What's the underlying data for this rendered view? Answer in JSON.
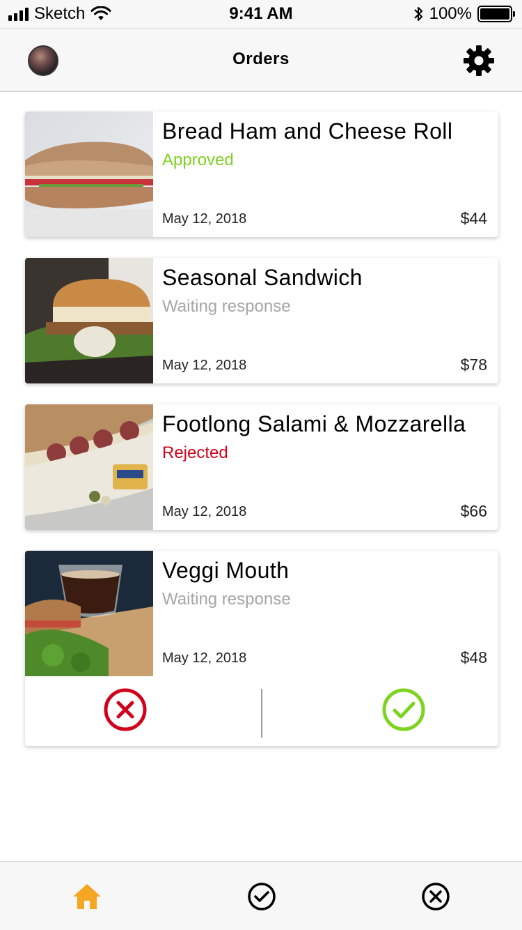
{
  "status_bar": {
    "carrier": "Sketch",
    "time": "9:41 AM",
    "battery": "100%"
  },
  "header": {
    "title": "Orders",
    "avatar_icon": "user-avatar",
    "settings_icon": "gear-icon"
  },
  "orders": [
    {
      "name": "Bread Ham and Cheese Roll",
      "status": "Approved",
      "status_color": "#7ed321",
      "date": "May 12, 2018",
      "price": "$44"
    },
    {
      "name": "Seasonal Sandwich",
      "status": "Waiting response",
      "status_color": "#a5a5a5",
      "date": "May 12, 2018",
      "price": "$78"
    },
    {
      "name": "Footlong Salami & Mozzarella",
      "status": "Rejected",
      "status_color": "#d0021b",
      "date": "May 12, 2018",
      "price": "$66"
    },
    {
      "name": "Veggi Mouth",
      "status": "Waiting response",
      "status_color": "#a5a5a5",
      "date": "May 12, 2018",
      "price": "$48"
    }
  ],
  "actions": {
    "reject_icon": "close-circle-icon",
    "reject_color": "#d0021b",
    "approve_icon": "check-circle-icon",
    "approve_color": "#7ed321"
  },
  "tab_bar": {
    "tabs": [
      {
        "icon": "home-icon",
        "active": true,
        "color": "#f5a623"
      },
      {
        "icon": "check-circle-icon",
        "active": false,
        "color": "#000000"
      },
      {
        "icon": "close-circle-icon",
        "active": false,
        "color": "#000000"
      }
    ]
  }
}
